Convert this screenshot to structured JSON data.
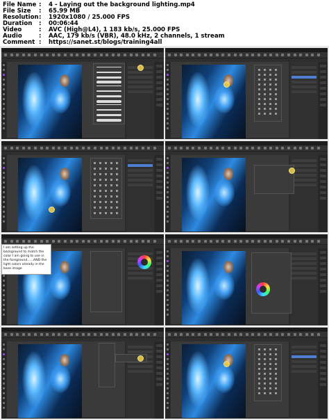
{
  "info": {
    "rows": [
      {
        "key": "File Name",
        "value": "4 - Laying out the background lighting.mp4"
      },
      {
        "key": "File Size",
        "value": "65.99 MB"
      },
      {
        "key": "Resolution",
        "value": "1920x1080 / 25.000 FPS"
      },
      {
        "key": "Duration",
        "value": "00:06:44"
      },
      {
        "key": "Video",
        "value": "AVC (High@L4), 1 183 kb/s, 25.000 FPS"
      },
      {
        "key": "Audio",
        "value": "AAC, 179 kb/s (VBR), 48.0 kHz, 2 channels, 1 stream"
      },
      {
        "key": "Comment",
        "value": "https://sanet.st/blogs/training4all"
      }
    ],
    "separator": ":"
  },
  "frames": [
    {
      "variant": "brushes"
    },
    {
      "variant": "layers"
    },
    {
      "variant": "grid-panel"
    },
    {
      "variant": "dialog"
    },
    {
      "variant": "color-wheel",
      "note": "I am setting up the background to match the color I am going to use in the foreground......AND the light colors already in the base image"
    },
    {
      "variant": "color-dialog"
    },
    {
      "variant": "menu"
    },
    {
      "variant": "layers-panel"
    }
  ],
  "colors": {
    "accent": "#4f7fd0",
    "tool_accent": "#8a4fbf",
    "cursor": "#f7e27a"
  }
}
